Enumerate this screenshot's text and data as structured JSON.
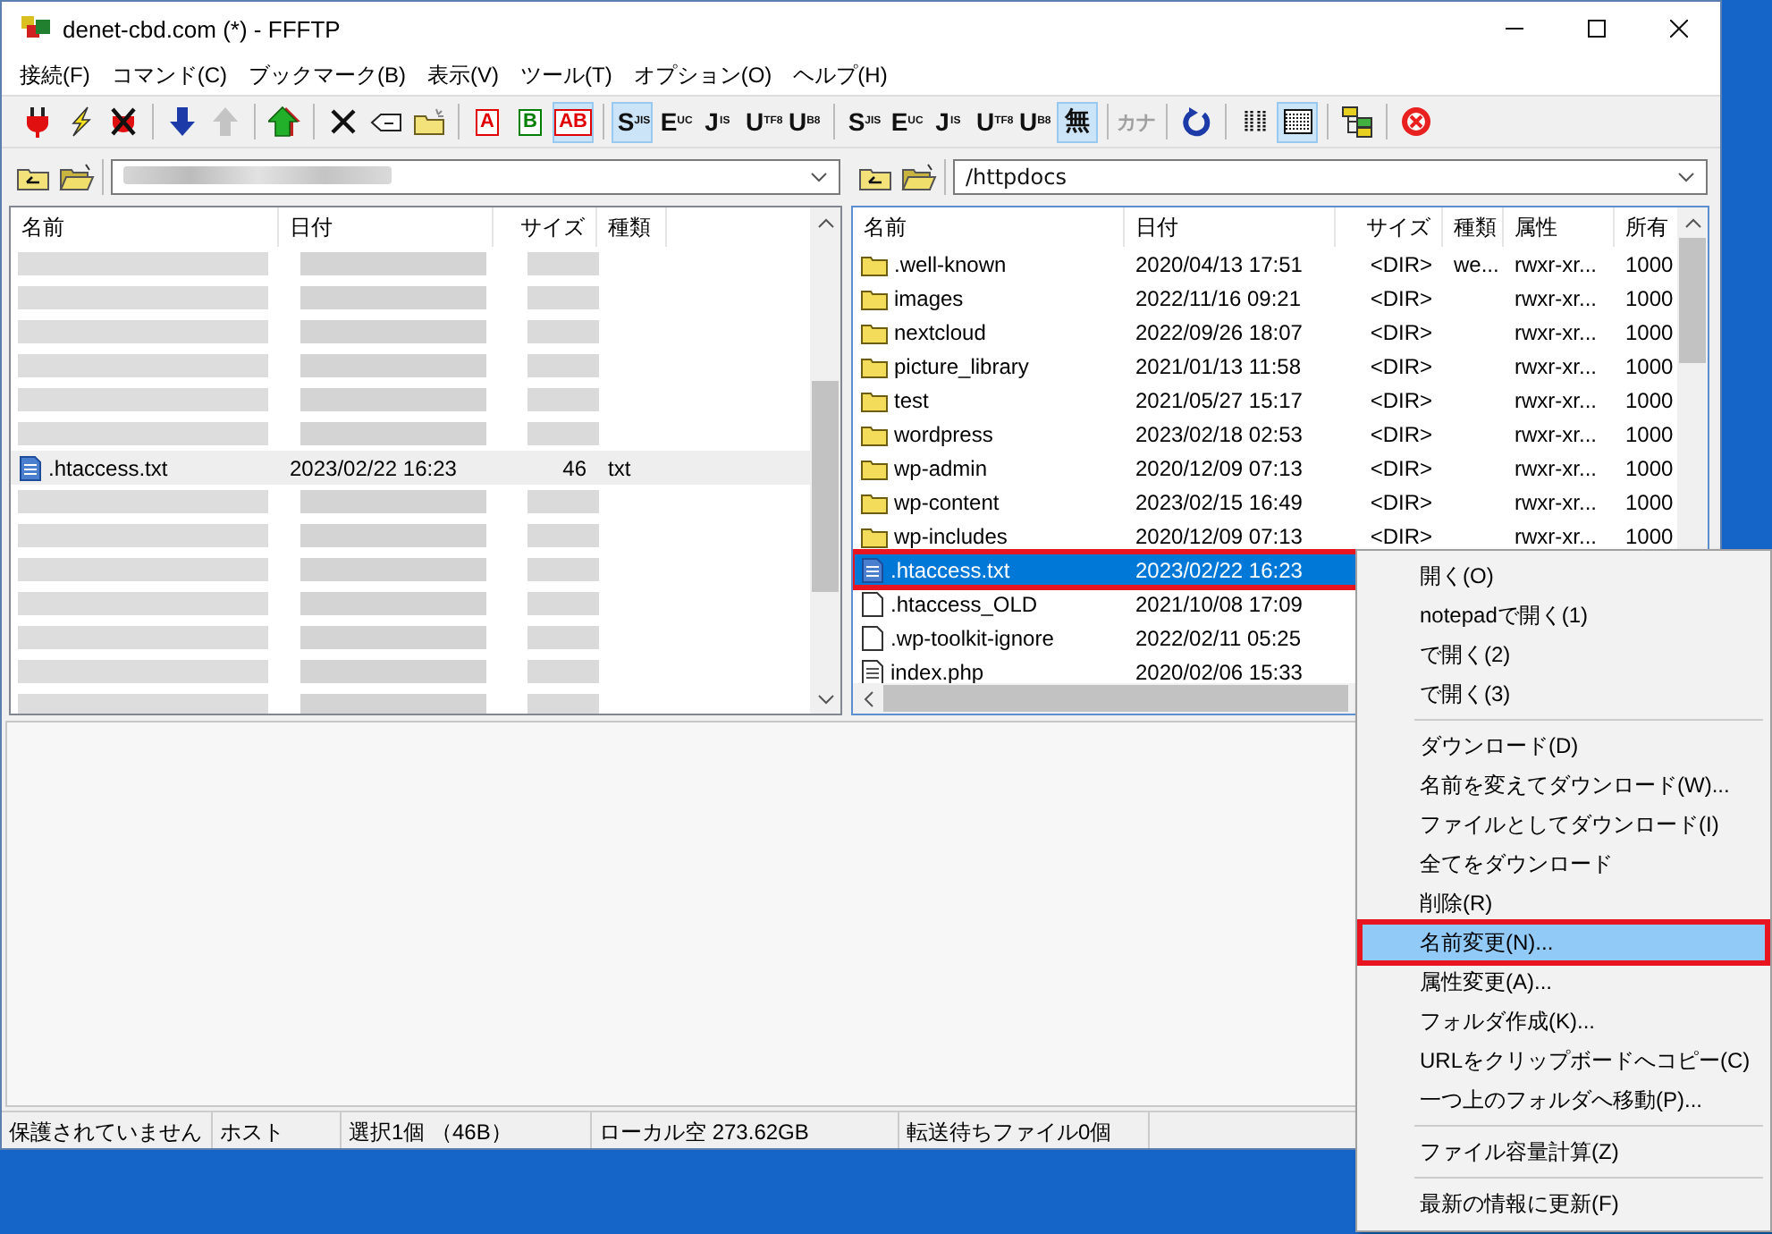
{
  "window": {
    "title": "denet-cbd.com (*) - FFFTP"
  },
  "menu_bar": [
    "接続(F)",
    "コマンド(C)",
    "ブックマーク(B)",
    "表示(V)",
    "ツール(T)",
    "オプション(O)",
    "ヘルプ(H)"
  ],
  "toolbar_groups": [
    {
      "buttons": [
        {
          "kind": "connect",
          "pressed": false,
          "disabled": false
        },
        {
          "kind": "quick",
          "pressed": false,
          "disabled": false
        },
        {
          "kind": "disconnect",
          "pressed": false,
          "disabled": false
        }
      ]
    },
    {
      "buttons": [
        {
          "kind": "download",
          "pressed": false,
          "disabled": false
        },
        {
          "kind": "upload",
          "pressed": false,
          "disabled": true
        }
      ]
    },
    {
      "buttons": [
        {
          "kind": "mirror",
          "pressed": false,
          "disabled": false
        }
      ]
    },
    {
      "buttons": [
        {
          "kind": "delete",
          "pressed": false,
          "disabled": false
        },
        {
          "kind": "rename",
          "pressed": false,
          "disabled": false
        },
        {
          "kind": "mkdir",
          "pressed": false,
          "disabled": false
        }
      ]
    },
    {
      "buttons": [
        {
          "kind": "mode",
          "label": "A",
          "color": "#e00000",
          "pressed": false,
          "disabled": false
        },
        {
          "kind": "mode",
          "label": "B",
          "color": "#008000",
          "pressed": false,
          "disabled": false
        },
        {
          "kind": "mode",
          "label": "AB",
          "color": "#e00000",
          "pressed": true,
          "disabled": false
        }
      ]
    },
    {
      "buttons": [
        {
          "kind": "code",
          "label": "S",
          "sub": "JIS",
          "pressed": true,
          "disabled": false
        },
        {
          "kind": "code",
          "label": "E",
          "sub": "UC",
          "pressed": false,
          "disabled": false
        },
        {
          "kind": "code",
          "label": "J",
          "sub": "IS",
          "pressed": false,
          "disabled": false
        },
        {
          "kind": "code",
          "label": "U",
          "sub": "TF8",
          "pressed": false,
          "disabled": false
        },
        {
          "kind": "code",
          "label": "U",
          "sub": "B8",
          "pressed": false,
          "disabled": false
        }
      ]
    },
    {
      "buttons": [
        {
          "kind": "code",
          "label": "S",
          "sub": "JIS",
          "pressed": false,
          "disabled": false
        },
        {
          "kind": "code",
          "label": "E",
          "sub": "UC",
          "pressed": false,
          "disabled": false
        },
        {
          "kind": "code",
          "label": "J",
          "sub": "IS",
          "pressed": false,
          "disabled": false
        },
        {
          "kind": "code",
          "label": "U",
          "sub": "TF8",
          "pressed": false,
          "disabled": false
        },
        {
          "kind": "code",
          "label": "U",
          "sub": "B8",
          "pressed": false,
          "disabled": false
        },
        {
          "kind": "code",
          "label": "無",
          "pressed": true,
          "disabled": false
        }
      ]
    },
    {
      "buttons": [
        {
          "kind": "code",
          "label": "カナ",
          "pressed": false,
          "disabled": true
        }
      ]
    },
    {
      "buttons": [
        {
          "kind": "refresh",
          "pressed": false,
          "disabled": false
        }
      ]
    },
    {
      "buttons": [
        {
          "kind": "list",
          "pressed": false,
          "disabled": false
        },
        {
          "kind": "details",
          "pressed": true,
          "disabled": false
        }
      ]
    },
    {
      "buttons": [
        {
          "kind": "sync",
          "pressed": false,
          "disabled": false
        }
      ]
    },
    {
      "buttons": [
        {
          "kind": "stop",
          "pressed": false,
          "disabled": false
        }
      ]
    }
  ],
  "local_pane": {
    "active": false,
    "path_blurred": true,
    "columns": [
      "名前",
      "日付",
      "サイズ",
      "種類"
    ],
    "rows": [
      {
        "kind": "blurred"
      },
      {
        "kind": "blurred"
      },
      {
        "kind": "blurred"
      },
      {
        "kind": "blurred"
      },
      {
        "kind": "blurred"
      },
      {
        "kind": "blurred"
      },
      {
        "kind": "text",
        "name": ".htaccess.txt",
        "date": "2023/02/22 16:23",
        "size": "46",
        "type": "txt",
        "selected": true,
        "annotated": false
      },
      {
        "kind": "blurred"
      },
      {
        "kind": "blurred"
      },
      {
        "kind": "blurred"
      },
      {
        "kind": "blurred"
      },
      {
        "kind": "blurred"
      },
      {
        "kind": "blurred"
      },
      {
        "kind": "blurred"
      }
    ]
  },
  "remote_pane": {
    "active": true,
    "path": "/httpdocs",
    "columns": [
      "名前",
      "日付",
      "サイズ",
      "種類",
      "属性",
      "所有"
    ],
    "rows": [
      {
        "kind": "folder",
        "name": ".well-known",
        "date": "2020/04/13 17:51",
        "size": "<DIR>",
        "type": "we...",
        "attr": "rwxr-xr...",
        "owner": "1000",
        "selected": false,
        "annotated": false
      },
      {
        "kind": "folder",
        "name": "images",
        "date": "2022/11/16 09:21",
        "size": "<DIR>",
        "attr": "rwxr-xr...",
        "owner": "1000",
        "selected": false,
        "annotated": false
      },
      {
        "kind": "folder",
        "name": "nextcloud",
        "date": "2022/09/26 18:07",
        "size": "<DIR>",
        "attr": "rwxr-xr...",
        "owner": "1000",
        "selected": false,
        "annotated": false
      },
      {
        "kind": "folder",
        "name": "picture_library",
        "date": "2021/01/13 11:58",
        "size": "<DIR>",
        "attr": "rwxr-xr...",
        "owner": "1000",
        "selected": false,
        "annotated": false
      },
      {
        "kind": "folder",
        "name": "test",
        "date": "2021/05/27 15:17",
        "size": "<DIR>",
        "attr": "rwxr-xr...",
        "owner": "1000",
        "selected": false,
        "annotated": false
      },
      {
        "kind": "folder",
        "name": "wordpress",
        "date": "2023/02/18 02:53",
        "size": "<DIR>",
        "attr": "rwxr-xr...",
        "owner": "1000",
        "selected": false,
        "annotated": false
      },
      {
        "kind": "folder",
        "name": "wp-admin",
        "date": "2020/12/09 07:13",
        "size": "<DIR>",
        "attr": "rwxr-xr...",
        "owner": "1000",
        "selected": false,
        "annotated": false
      },
      {
        "kind": "folder",
        "name": "wp-content",
        "date": "2023/02/15 16:49",
        "size": "<DIR>",
        "attr": "rwxr-xr...",
        "owner": "1000",
        "selected": false,
        "annotated": false
      },
      {
        "kind": "folder",
        "name": "wp-includes",
        "date": "2020/12/09 07:13",
        "size": "<DIR>",
        "attr": "rwxr-xr...",
        "owner": "1000",
        "selected": false,
        "annotated": false
      },
      {
        "kind": "text",
        "name": ".htaccess.txt",
        "date": "2023/02/22 16:23",
        "selected": true,
        "annotated": true
      },
      {
        "kind": "blank",
        "name": ".htaccess_OLD",
        "date": "2021/10/08 17:09",
        "selected": false,
        "annotated": false
      },
      {
        "kind": "blank",
        "name": ".wp-toolkit-ignore",
        "date": "2022/02/11 05:25",
        "selected": false,
        "annotated": false
      },
      {
        "kind": "script",
        "name": "index.php",
        "date": "2020/02/06 15:33",
        "selected": false,
        "annotated": false
      }
    ]
  },
  "status_bar": [
    "保護されていません",
    "ホスト",
    "選択1個 （46B）",
    "ローカル空 273.62GB",
    "転送待ちファイル0個"
  ],
  "context_menu": [
    {
      "kind": "item",
      "label": "開く(O)",
      "selected": false,
      "annotated": false
    },
    {
      "kind": "item",
      "label": "notepadで開く(1)",
      "selected": false,
      "annotated": false
    },
    {
      "kind": "item",
      "label": "で開く(2)",
      "selected": false,
      "annotated": false
    },
    {
      "kind": "item",
      "label": "で開く(3)",
      "selected": false,
      "annotated": false
    },
    {
      "kind": "separator"
    },
    {
      "kind": "item",
      "label": "ダウンロード(D)",
      "selected": false,
      "annotated": false
    },
    {
      "kind": "item",
      "label": "名前を変えてダウンロード(W)...",
      "selected": false,
      "annotated": false
    },
    {
      "kind": "item",
      "label": "ファイルとしてダウンロード(I)",
      "selected": false,
      "annotated": false
    },
    {
      "kind": "item",
      "label": "全てをダウンロード",
      "selected": false,
      "annotated": false
    },
    {
      "kind": "item",
      "label": "削除(R)",
      "selected": false,
      "annotated": false
    },
    {
      "kind": "item",
      "label": "名前変更(N)...",
      "selected": true,
      "annotated": true
    },
    {
      "kind": "item",
      "label": "属性変更(A)...",
      "selected": false,
      "annotated": false
    },
    {
      "kind": "item",
      "label": "フォルダ作成(K)...",
      "selected": false,
      "annotated": false
    },
    {
      "kind": "item",
      "label": "URLをクリップボードへコピー(C)",
      "selected": false,
      "annotated": false
    },
    {
      "kind": "item",
      "label": "一つ上のフォルダへ移動(P)...",
      "selected": false,
      "annotated": false
    },
    {
      "kind": "separator"
    },
    {
      "kind": "item",
      "label": "ファイル容量計算(Z)",
      "selected": false,
      "annotated": false
    },
    {
      "kind": "separator"
    },
    {
      "kind": "item",
      "label": "最新の情報に更新(F)",
      "selected": false,
      "annotated": false
    }
  ]
}
